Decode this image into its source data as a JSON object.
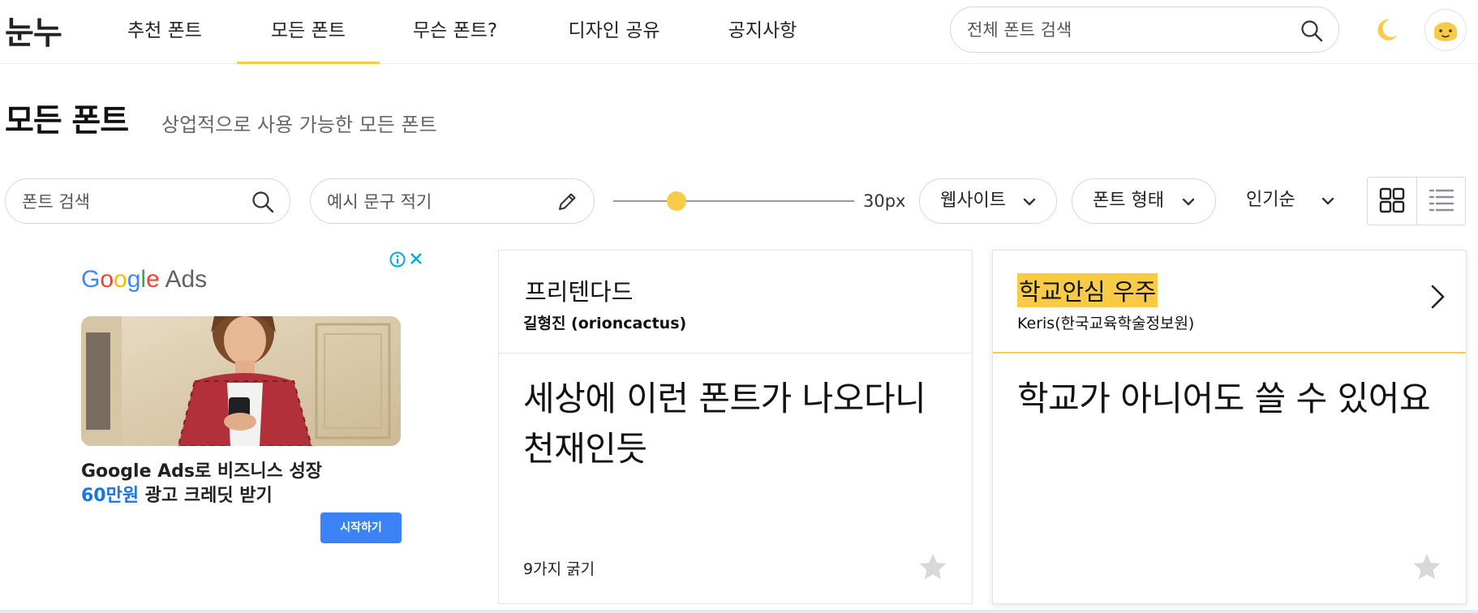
{
  "nav": {
    "logo": "눈누",
    "tabs": [
      {
        "label": "추천 폰트"
      },
      {
        "label": "모든 폰트",
        "active": true
      },
      {
        "label": "무슨 폰트?"
      },
      {
        "label": "디자인 공유"
      },
      {
        "label": "공지사항"
      }
    ],
    "search": {
      "placeholder": "전체 폰트 검색",
      "icon": "search-icon"
    },
    "theme_icon": "moon-icon",
    "avatar_icon": "avatar-face-icon"
  },
  "page": {
    "title": "모든 폰트",
    "subtitle": "상업적으로 사용 가능한 모든 폰트"
  },
  "filters": {
    "font_search": {
      "placeholder": "폰트 검색",
      "icon": "search-icon"
    },
    "sample_text": {
      "placeholder": "예시 문구 적기",
      "icon": "pencil-icon"
    },
    "size": {
      "label": "30px",
      "fraction": 0.24
    },
    "website_dropdown": {
      "label": "웹사이트"
    },
    "type_dropdown": {
      "label": "폰트 형태"
    },
    "sort_dropdown": {
      "label": "인기순"
    },
    "view_modes": [
      {
        "icon": "grid-view-icon",
        "active": true
      },
      {
        "icon": "list-view-icon",
        "active": false
      }
    ]
  },
  "ad": {
    "brand": {
      "g1": "G",
      "g2": "o",
      "g3": "o",
      "g4": "g",
      "g5": "l",
      "g6": "e",
      "suffix": " Ads"
    },
    "line1": "Google Ads로 비즈니스 성장",
    "line2_accent": "60만원",
    "line2_rest": " 광고 크레딧 받기",
    "cta": "시작하기"
  },
  "cards": [
    {
      "name": "프리텐다드",
      "author": "길형진 (orioncactus)",
      "sample": "세상에 이런 폰트가 나오다니 천재인듯",
      "weights": "9가지 굵기"
    },
    {
      "name": "학교안심 우주",
      "author": "Keris(한국교육학술정보원)",
      "sample": "학교가 아니어도 쓸 수 있어요",
      "weights": ""
    }
  ],
  "colors": {
    "accent": "#f7cb45",
    "ad_blue": "#1a73e8",
    "ad_button": "#3b82f6"
  }
}
